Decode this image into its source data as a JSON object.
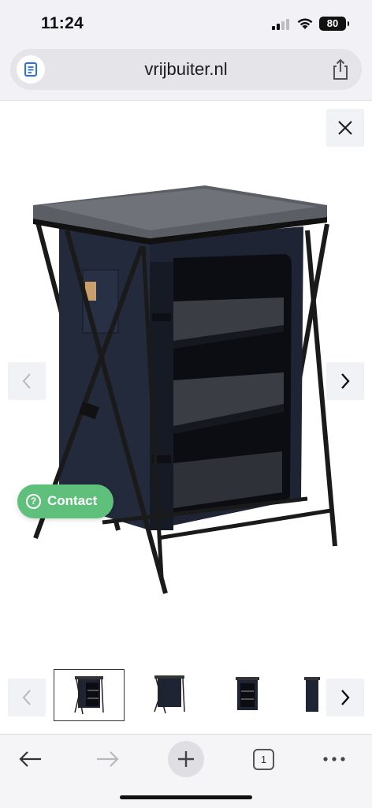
{
  "status": {
    "time": "11:24",
    "battery": "80"
  },
  "browser": {
    "url": "vrijbuiter.nl",
    "tab_count": "1"
  },
  "gallery": {
    "images": [
      "main-product",
      "thumb-1",
      "thumb-2",
      "thumb-3",
      "thumb-4"
    ],
    "active_thumb": 1
  },
  "contact": {
    "label": "Contact",
    "icon": "?"
  },
  "colors": {
    "contact_green": "#5ec07a",
    "fabric_navy": "#1e2433",
    "frame_black": "#1a1a1a"
  },
  "icons": [
    "reader-icon",
    "share-icon",
    "close-icon",
    "chevron-left-icon",
    "chevron-right-icon",
    "back-arrow-icon",
    "forward-arrow-icon",
    "plus-icon",
    "tabs-icon",
    "more-icon"
  ]
}
